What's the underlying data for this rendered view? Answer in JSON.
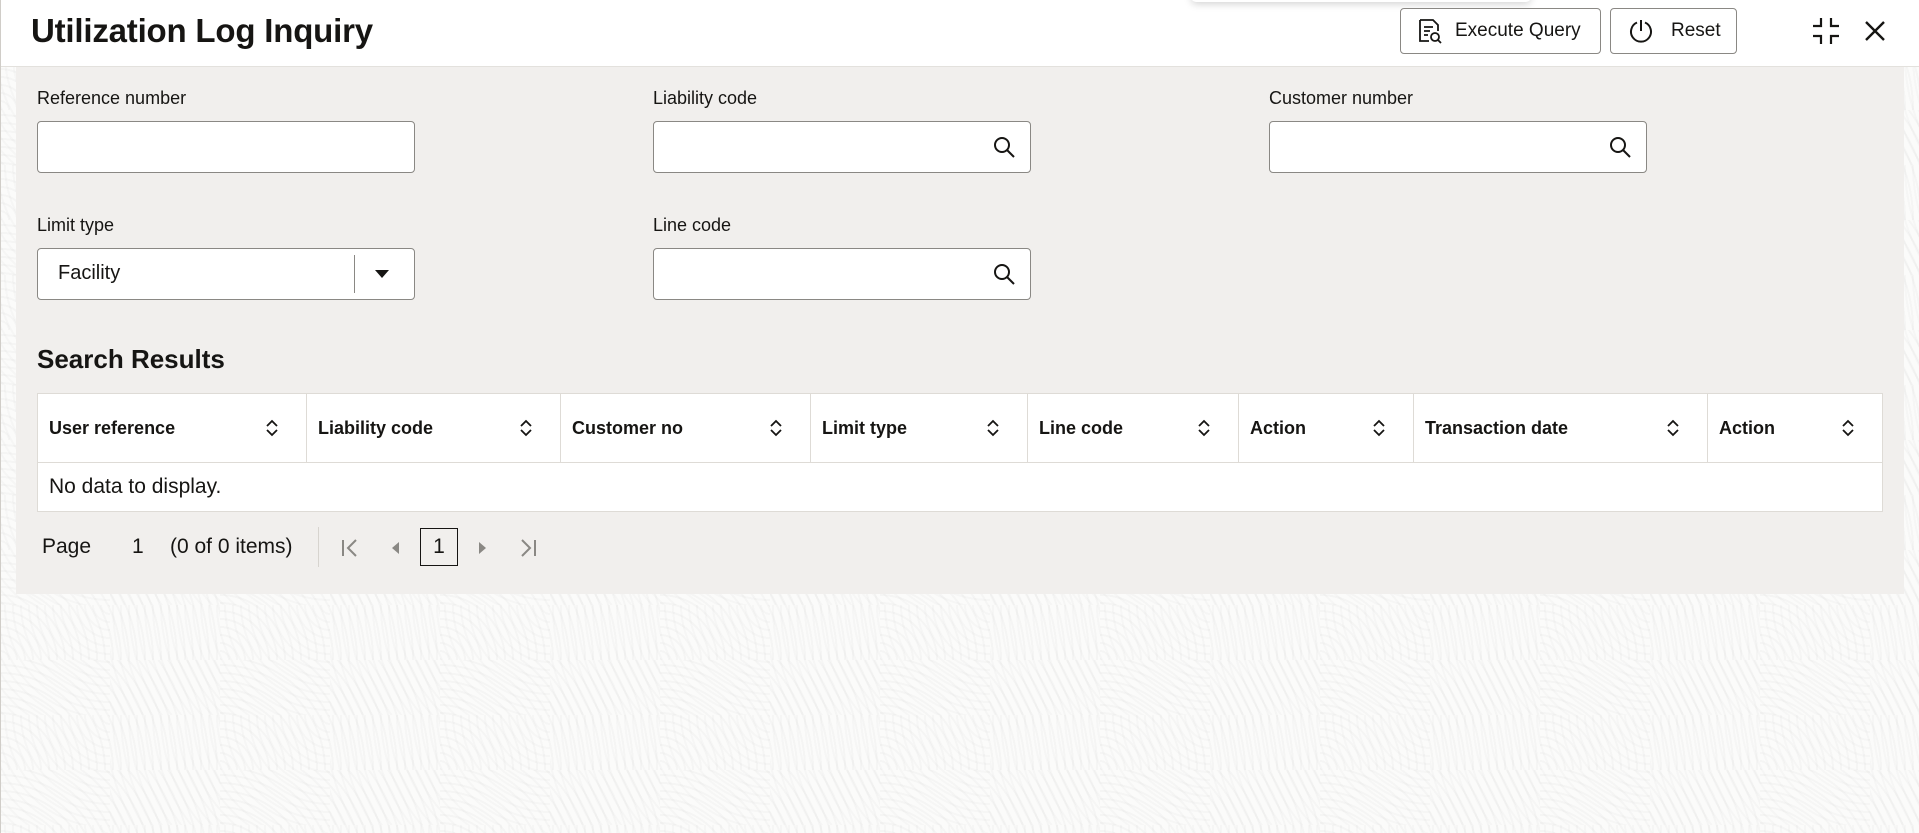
{
  "header": {
    "title": "Utilization Log Inquiry",
    "execute_query_label": "Execute Query",
    "reset_label": "Reset",
    "icons": {
      "execute": "query-document-icon",
      "reset": "power-reset-icon",
      "minimize": "collapse-arrows-icon",
      "close": "close-icon"
    }
  },
  "form": {
    "reference_number": {
      "label": "Reference number",
      "value": ""
    },
    "liability_code": {
      "label": "Liability code",
      "value": ""
    },
    "customer_number": {
      "label": "Customer number",
      "value": ""
    },
    "limit_type": {
      "label": "Limit type",
      "value": "Facility"
    },
    "line_code": {
      "label": "Line code",
      "value": ""
    }
  },
  "results": {
    "title": "Search Results",
    "columns": [
      "User reference",
      "Liability code",
      "Customer no",
      "Limit type",
      "Line code",
      "Action",
      "Transaction date",
      "Action"
    ],
    "empty_message": "No data to display."
  },
  "pagination": {
    "page_label": "Page",
    "page_number": "1",
    "items_summary": "(0 of 0 items)",
    "current_page": "1"
  },
  "colors": {
    "panel_background": "#f1efed",
    "border": "#8a8884",
    "text": "#161513"
  }
}
